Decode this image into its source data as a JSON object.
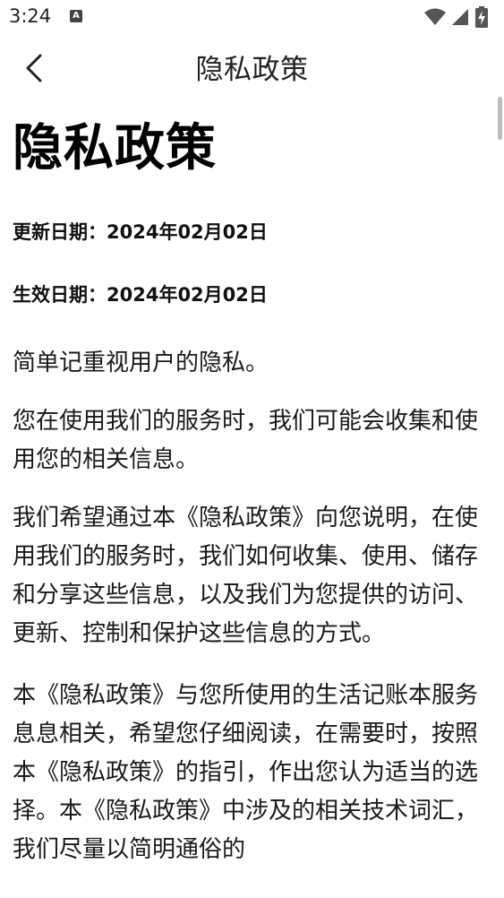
{
  "status_bar": {
    "time": "3:24",
    "notification_icon": "a-app-icon",
    "icons": [
      "wifi-icon",
      "signal-icon",
      "battery-charging-icon"
    ]
  },
  "app_bar": {
    "back_icon": "chevron-left-icon",
    "title": "隐私政策"
  },
  "document": {
    "title": "隐私政策",
    "updated_date": "更新日期：2024年02月02日",
    "effective_date": "生效日期：2024年02月02日",
    "paragraphs": [
      "简单记重视用户的隐私。",
      "您在使用我们的服务时，我们可能会收集和使用您的相关信息。",
      "我们希望通过本《隐私政策》向您说明，在使用我们的服务时，我们如何收集、使用、储存和分享这些信息，以及我们为您提供的访问、更新、控制和保护这些信息的方式。",
      "本《隐私政策》与您所使用的生活记账本服务息息相关，希望您仔细阅读，在需要时，按照本《隐私政策》的指引，作出您认为适当的选择。本《隐私政策》中涉及的相关技术词汇，我们尽量以简明通俗的"
    ]
  }
}
